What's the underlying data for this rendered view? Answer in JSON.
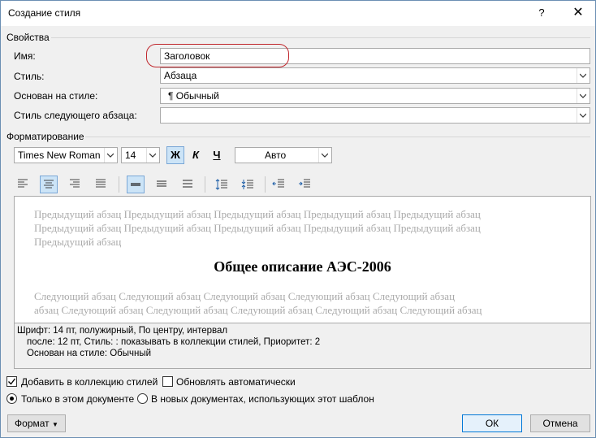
{
  "window": {
    "title": "Создание стиля",
    "help": "?",
    "close": "✕"
  },
  "properties": {
    "section_label": "Свойства",
    "name_label": "Имя:",
    "name_value": "Заголовок",
    "style_label": "Стиль:",
    "style_value": "Абзаца",
    "based_on_label": "Основан на стиле:",
    "based_on_value": "¶  Обычный",
    "next_style_label": "Стиль следующего абзаца:",
    "next_style_value": ""
  },
  "formatting": {
    "section_label": "Форматирование",
    "font": "Times New Roman",
    "size": "14",
    "bold": "Ж",
    "italic": "К",
    "underline": "Ч",
    "color": "Авто"
  },
  "preview": {
    "prev_line1": "Предыдущий абзац Предыдущий абзац Предыдущий абзац Предыдущий абзац Предыдущий абзац",
    "prev_line2": "Предыдущий абзац Предыдущий абзац Предыдущий абзац Предыдущий абзац Предыдущий абзац",
    "prev_line3": "Предыдущий абзац",
    "heading": "Общее описание АЭС-2006",
    "next_line1": "Следующий абзац Следующий абзац Следующий абзац Следующий абзац Следующий абзац",
    "next_line2": "абзац Следующий абзац Следующий абзац Следующий абзац Следующий абзац Следующий абзац"
  },
  "description": {
    "line1": "Шрифт: 14 пт, полужирный, По центру, интервал",
    "line2": "после: 12 пт, Стиль: : показывать в коллекции стилей, Приоритет: 2",
    "line3": "Основан на стиле: Обычный"
  },
  "options": {
    "add_to_gallery": "Добавить в коллекцию стилей",
    "add_to_gallery_checked": true,
    "auto_update": "Обновлять автоматически",
    "auto_update_checked": false,
    "only_this_doc": "Только в этом документе",
    "new_docs": "В новых документах, использующих этот шаблон",
    "selected_scope": "only_this_doc"
  },
  "buttons": {
    "format": "Формат",
    "ok": "ОК",
    "cancel": "Отмена"
  }
}
